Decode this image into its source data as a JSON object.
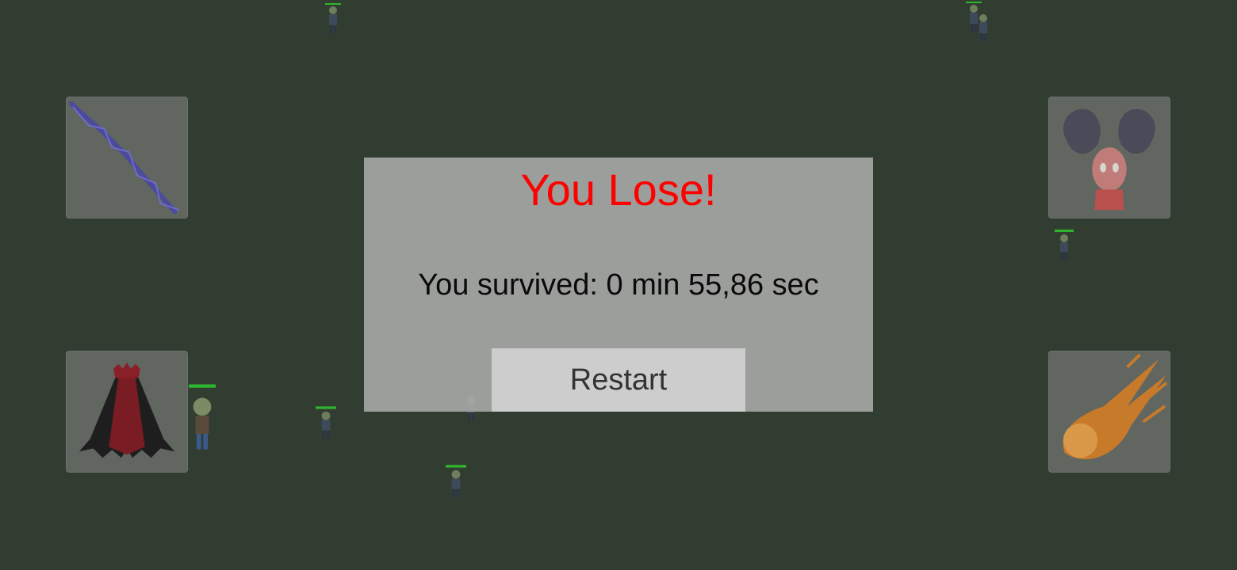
{
  "game_over": {
    "title": "You Lose!",
    "survived_text": "You survived: 0 min 55,86 sec",
    "restart_label": "Restart"
  },
  "colors": {
    "background": "#323d31",
    "title": "#ff0000",
    "panel": "#aaaca9",
    "button": "#cdcdcd"
  },
  "ability_slots": [
    {
      "name": "lightning-chain-icon"
    },
    {
      "name": "vampire-cape-icon"
    },
    {
      "name": "grasping-hands-icon"
    },
    {
      "name": "meteor-icon"
    }
  ]
}
